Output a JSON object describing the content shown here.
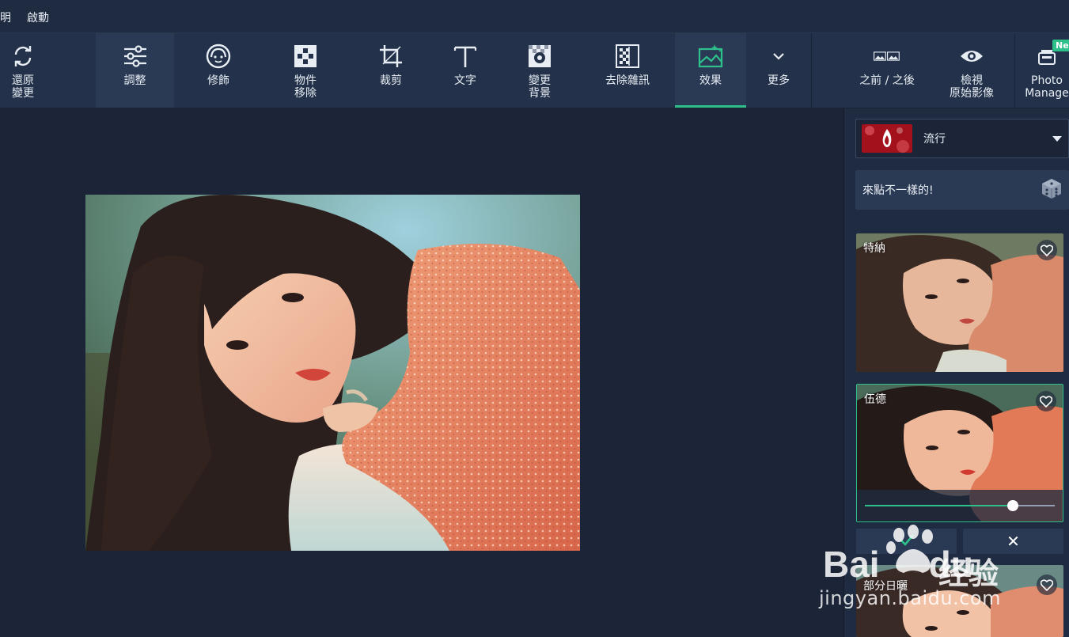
{
  "menu": {
    "items": [
      "明",
      "啟動"
    ]
  },
  "toolbar": {
    "tools": [
      {
        "label": "還原\n變更",
        "icon": "refresh-icon"
      },
      {
        "label": "調整",
        "icon": "sliders-icon"
      },
      {
        "label": "修飾",
        "icon": "face-icon"
      },
      {
        "label": "物件\n移除",
        "icon": "object-remove-icon"
      },
      {
        "label": "裁剪",
        "icon": "crop-icon"
      },
      {
        "label": "文字",
        "icon": "text-icon"
      },
      {
        "label": "變更\n背景",
        "icon": "background-icon"
      },
      {
        "label": "去除雜訊",
        "icon": "denoise-icon"
      },
      {
        "label": "效果",
        "icon": "effects-icon"
      },
      {
        "label": "更多",
        "icon": "chevron-down-icon"
      },
      {
        "label": "之前 / 之後",
        "icon": "before-after-icon"
      },
      {
        "label": "檢視\n原始影像",
        "icon": "eye-icon"
      },
      {
        "label": "Photo\nManage",
        "icon": "photo-manager-icon",
        "badge": "Ne"
      }
    ]
  },
  "panel": {
    "category": "流行",
    "random_label": "來點不一樣的!",
    "effects": [
      {
        "name": "特納"
      },
      {
        "name": "伍德",
        "intensity": 0.78
      },
      {
        "name": "部分日曬"
      }
    ],
    "confirm_icon": "check-icon",
    "cancel_label": "✕"
  },
  "watermark": {
    "brand": "Bai",
    "brand2": "du",
    "cn": "经验",
    "url": "jingyan.baidu.com"
  },
  "colors": {
    "accent": "#2dc08a",
    "background": "#1b2537",
    "toolbar": "#23324a"
  }
}
